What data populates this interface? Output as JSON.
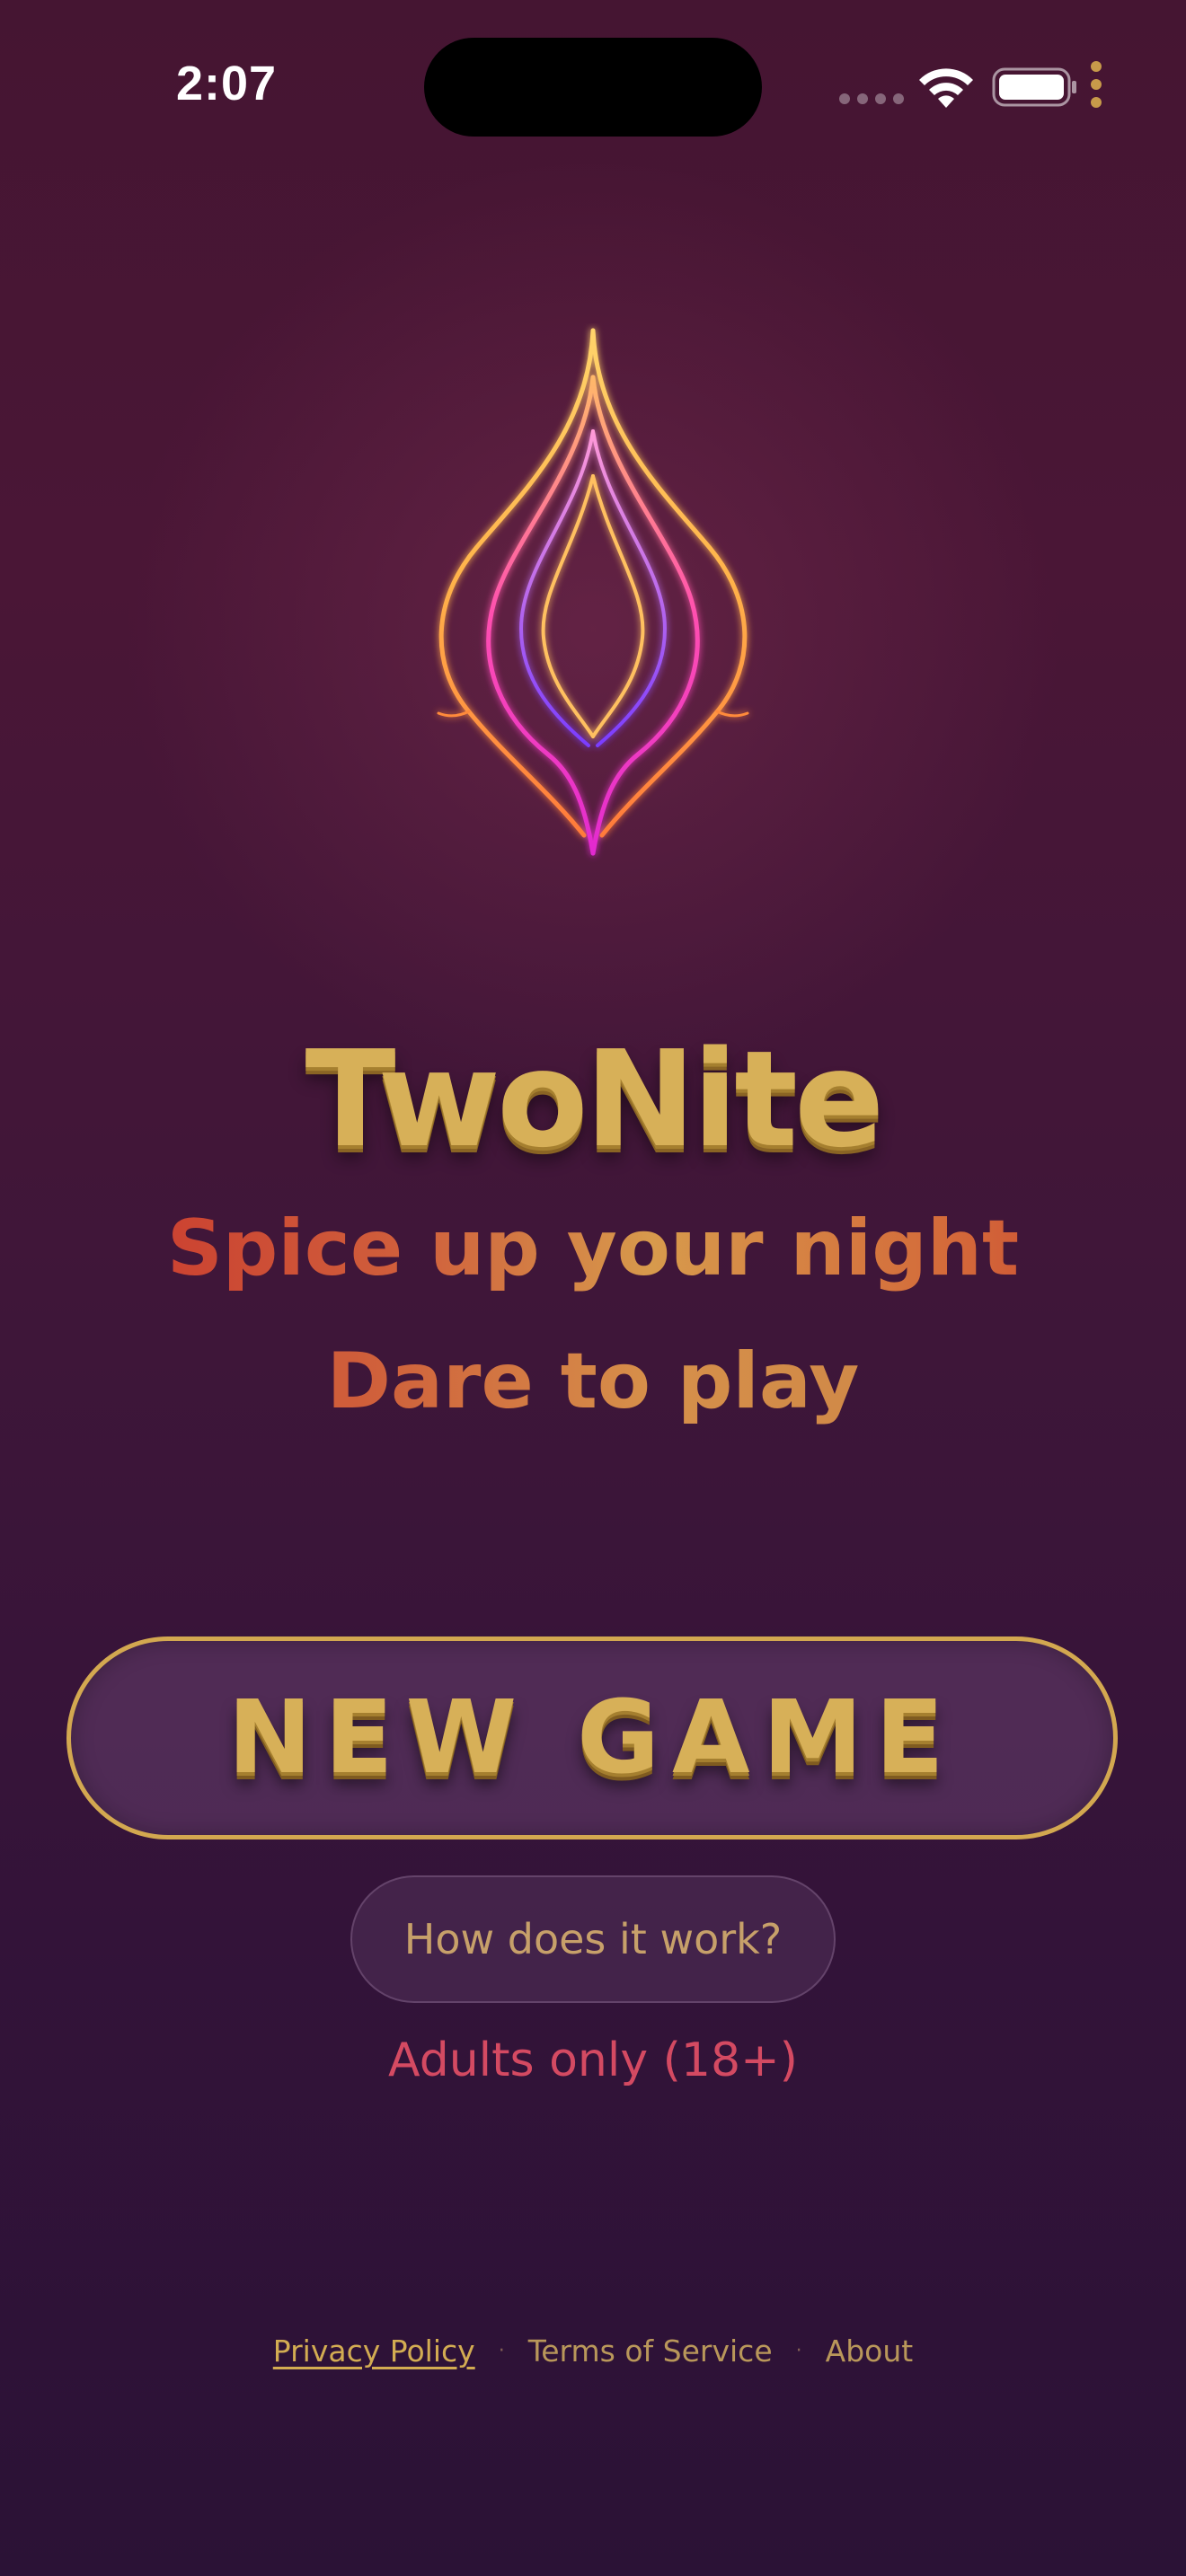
{
  "status_bar": {
    "time": "2:07"
  },
  "app": {
    "title": "TwoNite",
    "tagline_1": "Spice up your night",
    "tagline_2": "Dare to play"
  },
  "actions": {
    "new_game_label": "NEW GAME",
    "how_it_works_label": "How does it work?"
  },
  "notice": {
    "adults_only": "Adults only (18+)"
  },
  "footer": {
    "privacy": "Privacy Policy",
    "separator": "·",
    "terms": "Terms of Service",
    "about": "About"
  },
  "colors": {
    "gold": "#d7b058",
    "accent_red": "#d44a62",
    "background_top": "#451532",
    "background_bottom": "#2b1236"
  },
  "icons": {
    "logo": "flame-flower-logo-icon",
    "wifi": "wifi-icon",
    "battery": "battery-icon",
    "more": "more-dots-icon"
  }
}
